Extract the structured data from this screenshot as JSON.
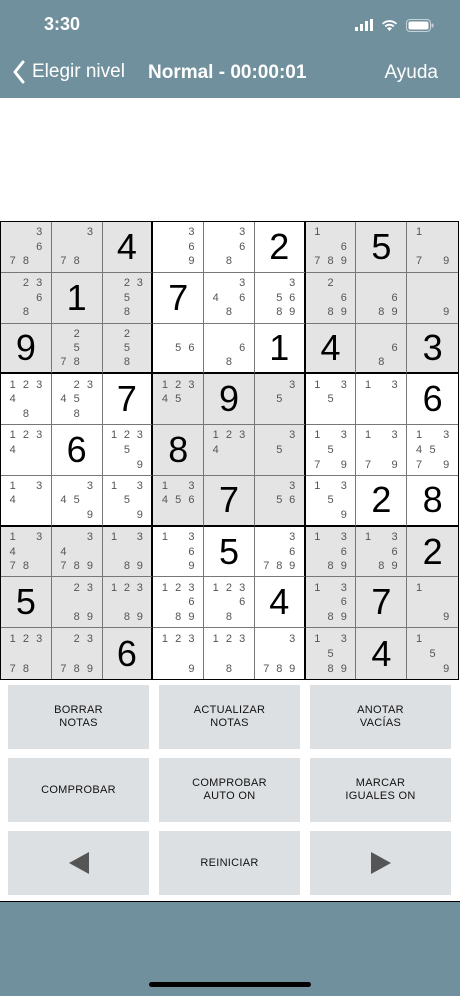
{
  "status_bar": {
    "time": "3:30"
  },
  "nav": {
    "back_label": "Elegir nivel",
    "title": "Normal - 00:00:01",
    "help_label": "Ayuda"
  },
  "board": {
    "cells": [
      [
        {
          "notes": [
            3,
            6,
            7,
            8
          ]
        },
        {
          "notes": [
            3,
            7,
            8
          ]
        },
        {
          "value": 4
        },
        {
          "notes": [
            3,
            6,
            9
          ]
        },
        {
          "notes": [
            3,
            6,
            8
          ]
        },
        {
          "value": 2
        },
        {
          "notes": [
            1,
            6,
            7,
            8,
            9
          ]
        },
        {
          "value": 5
        },
        {
          "notes": [
            1,
            7,
            9
          ]
        }
      ],
      [
        {
          "notes": [
            2,
            3,
            6,
            8
          ]
        },
        {
          "value": 1
        },
        {
          "notes": [
            2,
            3,
            5,
            8
          ]
        },
        {
          "value": 7
        },
        {
          "notes": [
            3,
            4,
            6,
            8
          ]
        },
        {
          "notes": [
            3,
            5,
            6,
            8,
            9
          ]
        },
        {
          "notes": [
            2,
            6,
            8,
            9
          ]
        },
        {
          "notes": [
            6,
            8,
            9
          ]
        },
        {
          "notes": [
            9
          ]
        }
      ],
      [
        {
          "value": 9
        },
        {
          "notes": [
            2,
            5,
            7,
            8
          ]
        },
        {
          "notes": [
            2,
            5,
            8
          ]
        },
        {
          "notes": [
            5,
            6
          ]
        },
        {
          "notes": [
            6,
            8
          ]
        },
        {
          "value": 1
        },
        {
          "value": 4
        },
        {
          "notes": [
            6,
            8
          ]
        },
        {
          "value": 3
        }
      ],
      [
        {
          "notes": [
            1,
            2,
            3,
            4,
            8
          ]
        },
        {
          "notes": [
            2,
            3,
            4,
            5,
            8
          ]
        },
        {
          "value": 7
        },
        {
          "notes": [
            1,
            2,
            3,
            4,
            5
          ]
        },
        {
          "value": 9
        },
        {
          "notes": [
            3,
            5
          ]
        },
        {
          "notes": [
            1,
            3,
            5
          ]
        },
        {
          "notes": [
            1,
            3
          ]
        },
        {
          "value": 6
        }
      ],
      [
        {
          "notes": [
            1,
            2,
            3,
            4
          ]
        },
        {
          "value": 6
        },
        {
          "notes": [
            1,
            2,
            3,
            5,
            9
          ]
        },
        {
          "value": 8
        },
        {
          "notes": [
            1,
            2,
            3,
            4
          ]
        },
        {
          "notes": [
            3,
            5
          ]
        },
        {
          "notes": [
            1,
            3,
            5,
            7,
            9
          ]
        },
        {
          "notes": [
            1,
            3,
            9,
            7
          ]
        },
        {
          "notes": [
            1,
            3,
            4,
            5,
            7,
            9
          ]
        }
      ],
      [
        {
          "notes": [
            1,
            3,
            4
          ]
        },
        {
          "notes": [
            3,
            4,
            5,
            9
          ]
        },
        {
          "notes": [
            1,
            3,
            5,
            9
          ]
        },
        {
          "notes": [
            1,
            3,
            4,
            5,
            6
          ]
        },
        {
          "value": 7
        },
        {
          "notes": [
            3,
            5,
            6
          ]
        },
        {
          "notes": [
            1,
            3,
            5,
            9
          ]
        },
        {
          "value": 2
        },
        {
          "value": 8
        }
      ],
      [
        {
          "notes": [
            1,
            3,
            4,
            7,
            8
          ]
        },
        {
          "notes": [
            3,
            4,
            7,
            8,
            9
          ]
        },
        {
          "notes": [
            1,
            3,
            8,
            9
          ]
        },
        {
          "notes": [
            1,
            3,
            6,
            9
          ]
        },
        {
          "value": 5
        },
        {
          "notes": [
            3,
            6,
            7,
            8,
            9
          ]
        },
        {
          "notes": [
            1,
            3,
            6,
            8,
            9
          ]
        },
        {
          "notes": [
            1,
            3,
            6,
            8,
            9
          ]
        },
        {
          "value": 2
        }
      ],
      [
        {
          "value": 5
        },
        {
          "notes": [
            2,
            3,
            8,
            9
          ]
        },
        {
          "notes": [
            1,
            2,
            3,
            8,
            9
          ]
        },
        {
          "notes": [
            1,
            2,
            3,
            6,
            9,
            8
          ]
        },
        {
          "notes": [
            1,
            2,
            3,
            6,
            8
          ]
        },
        {
          "value": 4
        },
        {
          "notes": [
            1,
            3,
            6,
            8,
            9
          ]
        },
        {
          "value": 7
        },
        {
          "notes": [
            1,
            9
          ]
        }
      ],
      [
        {
          "notes": [
            1,
            2,
            3,
            7,
            8
          ]
        },
        {
          "notes": [
            2,
            3,
            7,
            8,
            9
          ]
        },
        {
          "value": 6
        },
        {
          "notes": [
            1,
            2,
            3,
            9
          ]
        },
        {
          "notes": [
            1,
            2,
            3,
            8
          ]
        },
        {
          "notes": [
            3,
            7,
            8,
            9
          ]
        },
        {
          "notes": [
            1,
            3,
            5,
            8,
            9
          ]
        },
        {
          "value": 4
        },
        {
          "notes": [
            1,
            5,
            9
          ]
        }
      ]
    ],
    "shaded": [
      [
        true,
        true,
        true,
        false,
        false,
        false,
        true,
        true,
        true
      ],
      [
        true,
        true,
        true,
        false,
        false,
        false,
        true,
        true,
        true
      ],
      [
        true,
        true,
        true,
        false,
        false,
        false,
        true,
        true,
        true
      ],
      [
        false,
        false,
        false,
        true,
        true,
        true,
        false,
        false,
        false
      ],
      [
        false,
        false,
        false,
        true,
        true,
        true,
        false,
        false,
        false
      ],
      [
        false,
        false,
        false,
        true,
        true,
        true,
        false,
        false,
        false
      ],
      [
        true,
        true,
        true,
        false,
        false,
        false,
        true,
        true,
        true
      ],
      [
        true,
        true,
        true,
        false,
        false,
        false,
        true,
        true,
        true
      ],
      [
        true,
        true,
        true,
        false,
        false,
        false,
        true,
        true,
        true
      ]
    ]
  },
  "controls": {
    "erase_notes": "BORRAR\nNOTAS",
    "update_notes": "ACTUALIZAR\nNOTAS",
    "note_empty": "ANOTAR\nVACÍAS",
    "check": "COMPROBAR",
    "check_auto": "COMPROBAR\nAUTO ON",
    "mark_same": "MARCAR\nIGUALES ON",
    "restart": "REINICIAR",
    "prev_icon": "left-triangle-icon",
    "next_icon": "right-triangle-icon"
  },
  "colors": {
    "bar": "#71909d",
    "button": "#dde0e3",
    "shaded_cell": "#e4e4e4"
  }
}
